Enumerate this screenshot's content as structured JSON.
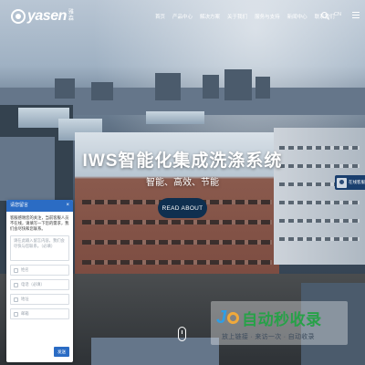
{
  "header": {
    "logo_text": "yasen",
    "logo_cn": "雅森",
    "nav": [
      "首页",
      "产品中心",
      "解决方案",
      "关于我们",
      "服务与支持",
      "新闻中心",
      "联系我们"
    ],
    "lang": "CN"
  },
  "hero": {
    "title": "IWS智能化集成洗涤系统",
    "subtitle": "智能、高效、节能",
    "button": "READ ABOUT"
  },
  "service": {
    "label": "在线客服"
  },
  "message_form": {
    "title": "请您留言",
    "close": "×",
    "intro": "客服感谢您的关注，当前客服人员不在线，请填写一下您的需求，我们会尽快和您联系。",
    "message_placeholder": "请在此输入留言内容，我们会尽快与您联系。（必填）",
    "name_placeholder": "姓名",
    "phone_placeholder": "电话（必填）",
    "address_placeholder": "地址",
    "email_placeholder": "邮箱",
    "send": "发送"
  },
  "watermark": {
    "brand": "自动秒收录",
    "slogan": "放上链接 · 来访一次 · 自动收录"
  },
  "colors": {
    "accent": "#2b6cc4",
    "button_dark": "#0f2f4f"
  }
}
